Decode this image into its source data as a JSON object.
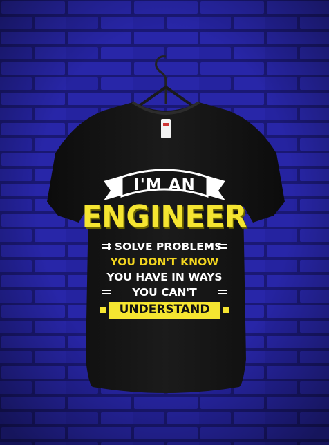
{
  "scene": {
    "wall_color": "#1f1d8a",
    "shirt_color": "#151515",
    "accent_yellow": "#f5e531",
    "hanger_icon": "hanger-icon"
  },
  "shirt": {
    "tag_text": "",
    "banner": "I'M AN",
    "headline": "ENGINEER",
    "line1": "I SOLVE PROBLEMS",
    "line2": "YOU DON'T KNOW",
    "line3": "YOU HAVE IN WAYS",
    "line4": "YOU CAN'T",
    "line5": "UNDERSTAND"
  }
}
